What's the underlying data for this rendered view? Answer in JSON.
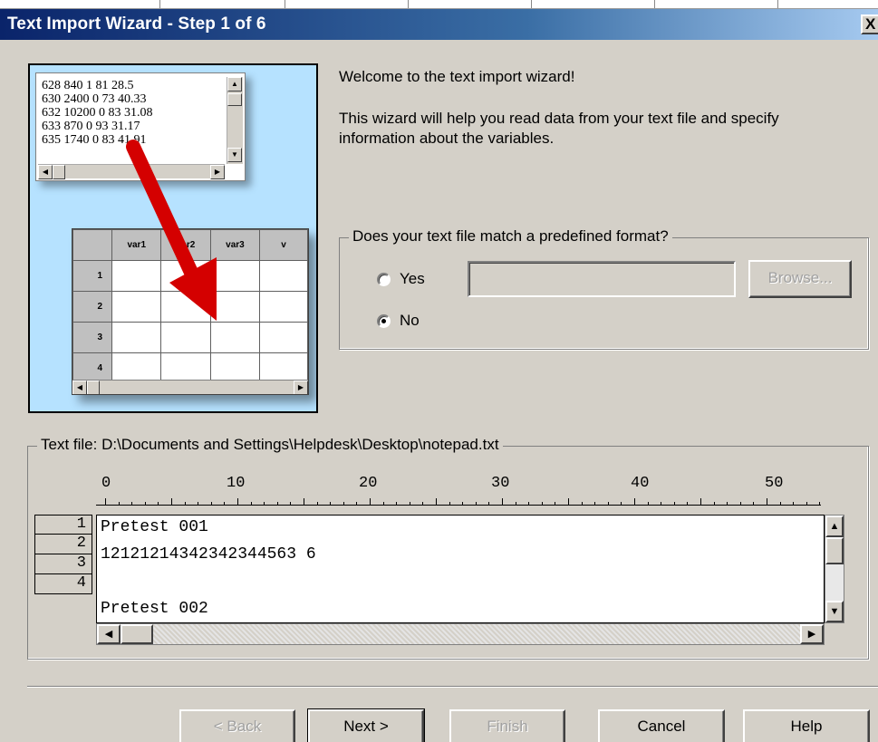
{
  "window": {
    "title": "Text Import Wizard - Step 1 of 6",
    "close_label": "X"
  },
  "illustration": {
    "notepad_lines": [
      "628 840 1 81 28.5",
      "630 2400 0 73 40.33",
      "632 10200 0 83 31.08",
      "633 870 0 93 31.17",
      "635 1740 0 83 41.91"
    ],
    "grid_headers": [
      "var1",
      "var2",
      "var3",
      "v"
    ],
    "grid_rows": [
      "1",
      "2",
      "3",
      "4"
    ]
  },
  "welcome_text": "Welcome to the text import wizard!",
  "intro_text": "This wizard will help you read data from your text file and specify information about the variables.",
  "format_group": {
    "legend": "Does your text file match a predefined format?",
    "options": [
      {
        "label": "Yes",
        "selected": false
      },
      {
        "label": "No",
        "selected": true
      }
    ],
    "path_value": "",
    "browse_label": "Browse..."
  },
  "file_group": {
    "legend": "Text file: D:\\Documents and Settings\\Helpdesk\\Desktop\\notepad.txt",
    "ruler_labels": [
      "0",
      "10",
      "20",
      "30",
      "40",
      "50"
    ],
    "row_numbers": [
      "1",
      "2",
      "3",
      "4"
    ],
    "lines": [
      "Pretest 001",
      "12121214342342344563 6",
      "",
      "Pretest 002"
    ]
  },
  "buttons": {
    "back": "< Back",
    "next": "Next >",
    "finish": "Finish",
    "cancel": "Cancel",
    "help": "Help"
  },
  "colors": {
    "title_gradient_start": "#0a246a",
    "illustration_bg": "#b6e2ff",
    "arrow_red": "#d40000"
  }
}
